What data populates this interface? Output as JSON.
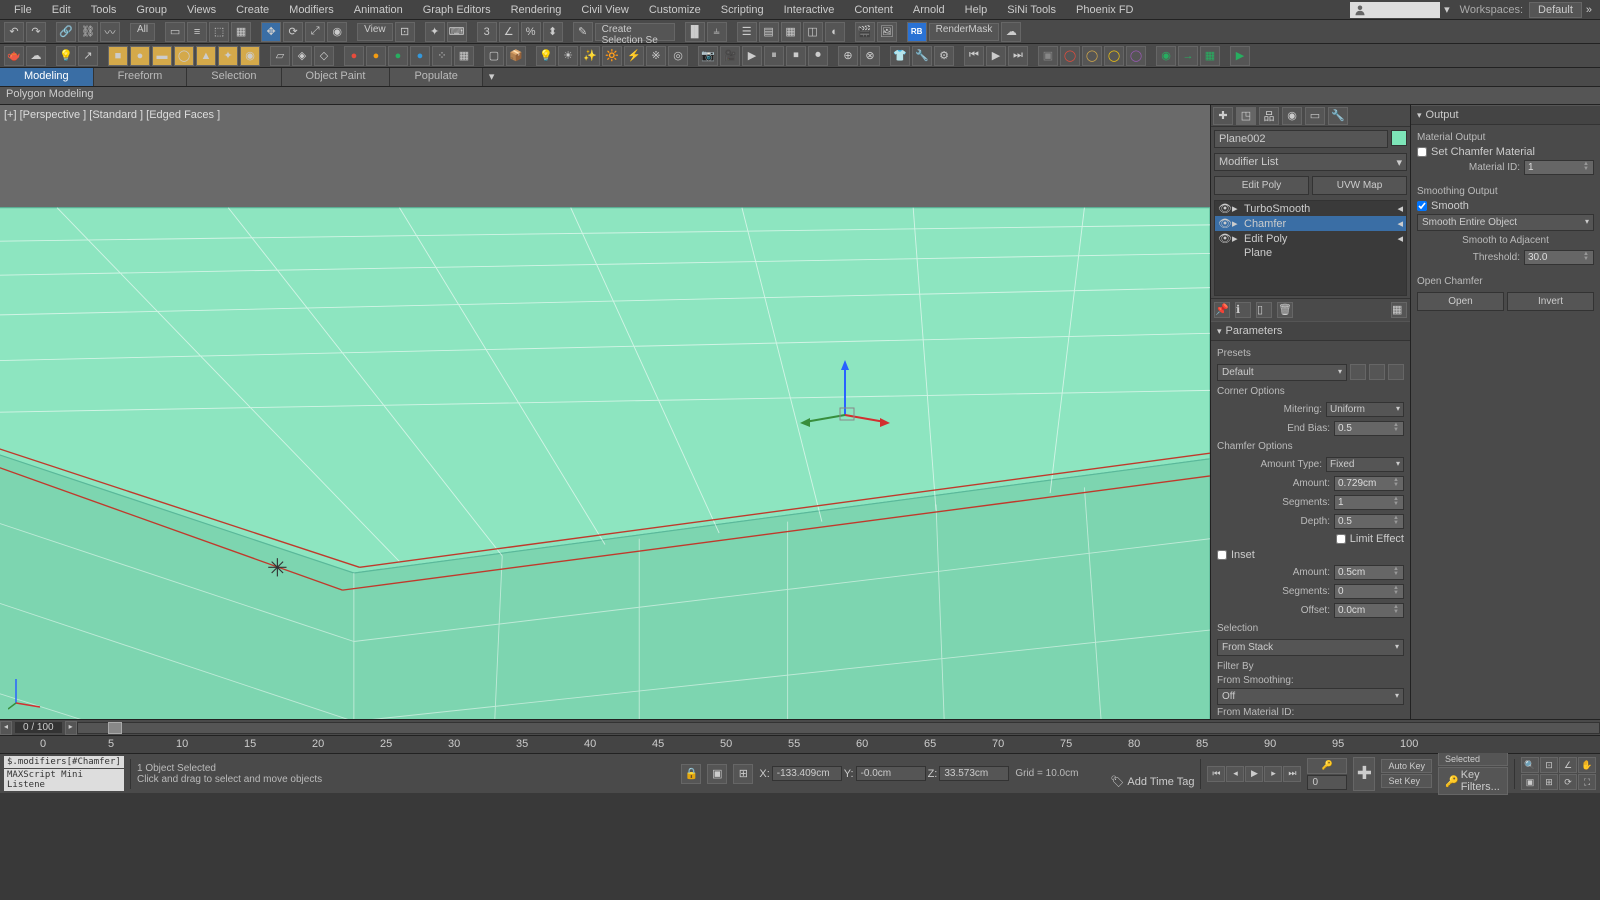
{
  "menu": [
    "File",
    "Edit",
    "Tools",
    "Group",
    "Views",
    "Create",
    "Modifiers",
    "Animation",
    "Graph Editors",
    "Rendering",
    "Civil View",
    "Customize",
    "Scripting",
    "Interactive",
    "Content",
    "Arnold",
    "Help",
    "SiNi Tools",
    "Phoenix FD"
  ],
  "workspace": {
    "label": "Workspaces:",
    "value": "Default"
  },
  "toolbar_sel": {
    "label": "All"
  },
  "toolbar_view": {
    "label": "View"
  },
  "toolbar_create_sel": {
    "label": "Create Selection Se"
  },
  "rendermask": "RenderMask",
  "ribbon_tabs": [
    "Modeling",
    "Freeform",
    "Selection",
    "Object Paint",
    "Populate"
  ],
  "subribbon": "Polygon Modeling",
  "viewport_label": "[+] [Perspective ] [Standard ] [Edged Faces ]",
  "object_name": "Plane002",
  "modifier_list": "Modifier List",
  "mod_buttons": {
    "edit_poly": "Edit Poly",
    "uvw": "UVW Map"
  },
  "stack": [
    {
      "name": "TurboSmooth",
      "eye": true,
      "indent": 1
    },
    {
      "name": "Chamfer",
      "eye": true,
      "indent": 1,
      "selected": true
    },
    {
      "name": "Edit Poly",
      "eye": true,
      "indent": 1
    },
    {
      "name": "Plane",
      "eye": false,
      "indent": 0
    }
  ],
  "rollouts": {
    "parameters": "Parameters",
    "presets": "Presets",
    "preset_value": "Default",
    "corner_options": "Corner Options",
    "mitering": {
      "label": "Mitering:",
      "value": "Uniform"
    },
    "end_bias": {
      "label": "End Bias:",
      "value": "0.5"
    },
    "chamfer_options": "Chamfer Options",
    "amount_type": {
      "label": "Amount Type:",
      "value": "Fixed"
    },
    "amount": {
      "label": "Amount:",
      "value": "0.729cm"
    },
    "segments": {
      "label": "Segments:",
      "value": "1"
    },
    "depth": {
      "label": "Depth:",
      "value": "0.5"
    },
    "limit_effect": "Limit Effect",
    "inset": "Inset",
    "inset_amount": {
      "label": "Amount:",
      "value": "0.5cm"
    },
    "inset_segments": {
      "label": "Segments:",
      "value": "0"
    },
    "inset_offset": {
      "label": "Offset:",
      "value": "0.0cm"
    },
    "selection": "Selection",
    "from_stack": "From Stack",
    "filter_by": "Filter By",
    "from_smoothing": "From Smoothing:",
    "filter_value": "Off",
    "from_material": "From Material ID:"
  },
  "output": {
    "header": "Output",
    "material_output": "Material Output",
    "set_chamfer": "Set Chamfer Material",
    "material_id": {
      "label": "Material ID:",
      "value": "1"
    },
    "smoothing_output": "Smoothing Output",
    "smooth": "Smooth",
    "smooth_mode": "Smooth Entire Object",
    "smooth_adjacent": "Smooth to Adjacent",
    "threshold": {
      "label": "Threshold:",
      "value": "30.0"
    },
    "open_chamfer": "Open Chamfer",
    "open": "Open",
    "invert": "Invert"
  },
  "timeline": {
    "frame": "0 / 100"
  },
  "ruler_ticks": [
    0,
    5,
    10,
    15,
    20,
    25,
    30,
    35,
    40,
    45,
    50,
    55,
    60,
    65,
    70,
    75,
    80,
    85,
    90,
    95,
    100
  ],
  "status": {
    "script1": "$.modifiers[#Chamfer]",
    "script2": "MAXScript Mini Listene",
    "selected": "1 Object Selected",
    "hint": "Click and drag to select and move objects",
    "x": {
      "label": "X:",
      "value": "-133.409cm"
    },
    "y": {
      "label": "Y:",
      "value": "-0.0cm"
    },
    "z": {
      "label": "Z:",
      "value": "33.573cm"
    },
    "grid": "Grid = 10.0cm",
    "add_time_tag": "Add Time Tag",
    "auto_key": "Auto Key",
    "set_key": "Set Key",
    "selected_mode": "Selected",
    "key_filters": "Key Filters...",
    "frame_input": "0"
  }
}
